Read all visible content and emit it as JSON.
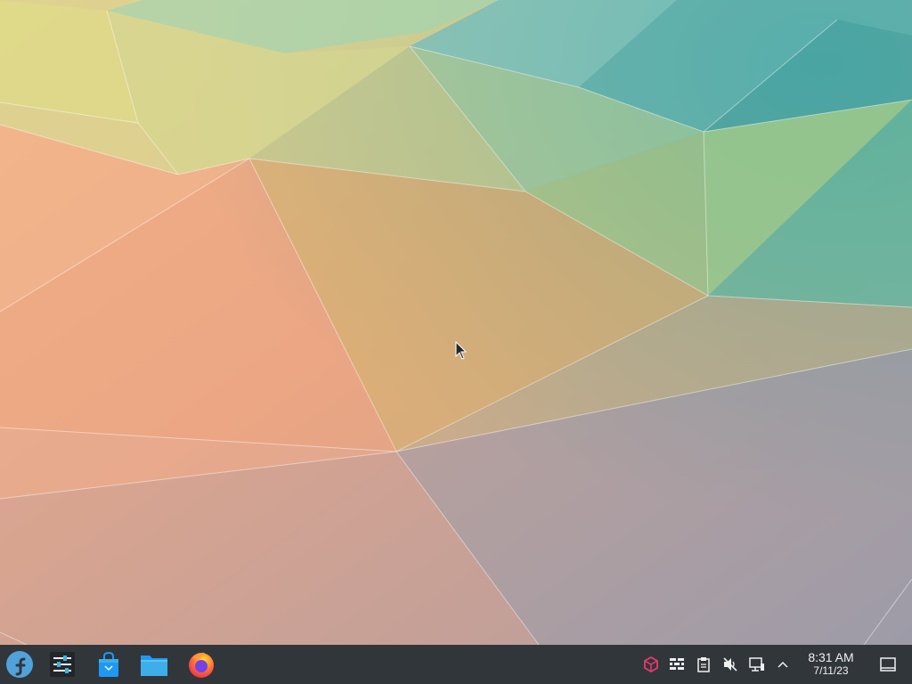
{
  "desktop": {
    "wallpaper_icon": "kde-polygon-wallpaper",
    "cursor_icon": "arrow-cursor-icon"
  },
  "taskbar": {
    "background": "#31363b",
    "launchers": [
      {
        "name": "fedora-application-launcher",
        "icon": "fedora-icon"
      },
      {
        "name": "system-settings",
        "icon": "settings-sliders-icon"
      },
      {
        "name": "discover-software-center",
        "icon": "shopping-bag-icon"
      },
      {
        "name": "dolphin-file-manager",
        "icon": "folder-icon"
      },
      {
        "name": "firefox-browser",
        "icon": "firefox-icon"
      }
    ],
    "tray": [
      {
        "name": "package-updates",
        "icon": "package-icon",
        "color": "#e93a6b"
      },
      {
        "name": "firewall",
        "icon": "firewall-icon"
      },
      {
        "name": "clipboard",
        "icon": "clipboard-icon"
      },
      {
        "name": "volume-muted",
        "icon": "speaker-muted-icon"
      },
      {
        "name": "network",
        "icon": "wired-network-icon"
      },
      {
        "name": "expand-tray",
        "icon": "chevron-up-icon"
      }
    ],
    "clock": {
      "time": "8:31 AM",
      "date": "7/11/23"
    },
    "show_desktop_icon": "show-desktop-icon"
  }
}
